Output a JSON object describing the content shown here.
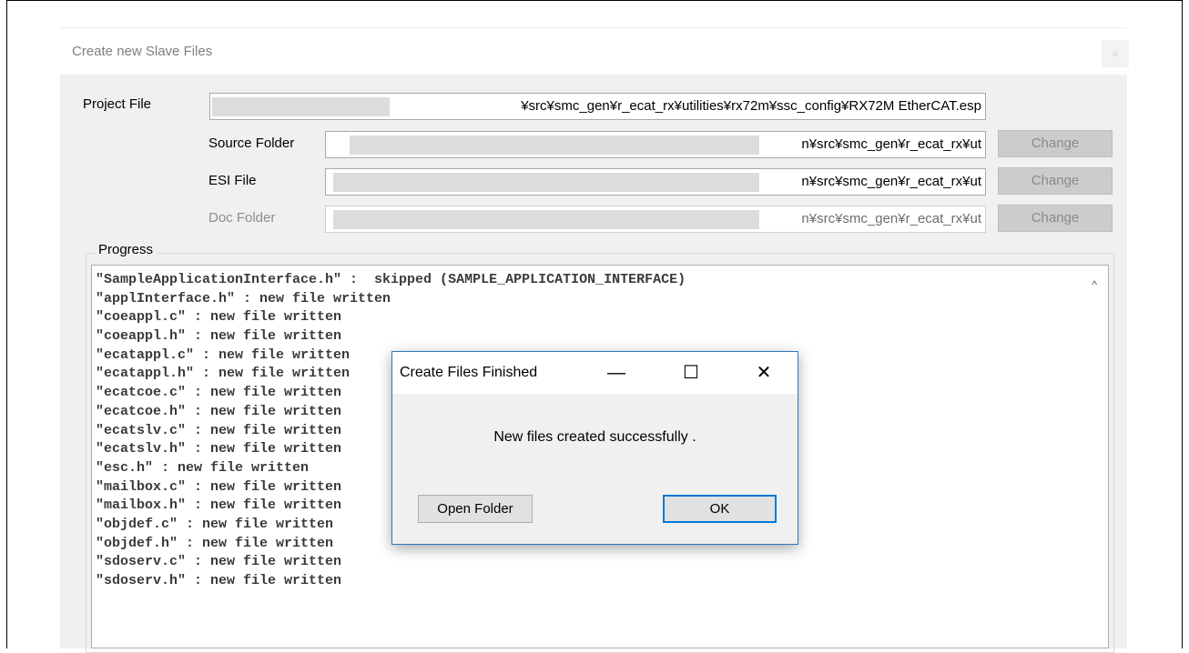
{
  "window": {
    "title": "Create new Slave Files",
    "close_glyph": "×"
  },
  "form": {
    "project_file": {
      "label": "Project File",
      "value": "¥src¥smc_gen¥r_ecat_rx¥utilities¥rx72m¥ssc_config¥RX72M EtherCAT.esp"
    },
    "source_folder": {
      "label": "Source Folder",
      "value": "n¥src¥smc_gen¥r_ecat_rx¥ut",
      "change_label": "Change"
    },
    "esi_file": {
      "label": "ESI File",
      "value": "n¥src¥smc_gen¥r_ecat_rx¥ut",
      "change_label": "Change"
    },
    "doc_folder": {
      "label": "Doc Folder",
      "value": "n¥src¥smc_gen¥r_ecat_rx¥ut",
      "change_label": "Change"
    }
  },
  "progress": {
    "label": "Progress",
    "lines": [
      "\"SampleApplicationInterface.h\" :  skipped (SAMPLE_APPLICATION_INTERFACE)",
      "\"applInterface.h\" : new file written",
      "\"coeappl.c\" : new file written",
      "\"coeappl.h\" : new file written",
      "\"ecatappl.c\" : new file written",
      "\"ecatappl.h\" : new file written",
      "\"ecatcoe.c\" : new file written",
      "\"ecatcoe.h\" : new file written",
      "\"ecatslv.c\" : new file written",
      "\"ecatslv.h\" : new file written",
      "\"esc.h\" : new file written",
      "\"mailbox.c\" : new file written",
      "\"mailbox.h\" : new file written",
      "\"objdef.c\" : new file written",
      "\"objdef.h\" : new file written",
      "\"sdoserv.c\" : new file written",
      "\"sdoserv.h\" : new file written"
    ],
    "scroll_up_glyph": "^"
  },
  "dialog": {
    "title": "Create Files Finished",
    "minimize_glyph": "—",
    "maximize_glyph": "☐",
    "close_glyph": "✕",
    "message": "New files created successfully .",
    "open_folder_label": "Open Folder",
    "ok_label": "OK"
  }
}
